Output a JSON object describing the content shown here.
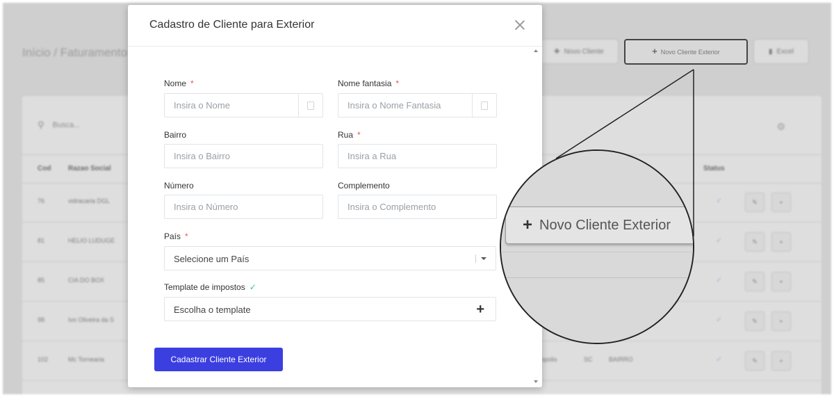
{
  "background": {
    "breadcrumb": "Início / Faturamento",
    "buttons": {
      "novo_cliente": "Novo Cliente",
      "novo_cliente_exterior": "Novo Cliente Exterior",
      "excel": "Excel"
    },
    "search_placeholder": "Busca...",
    "table": {
      "headers": {
        "cod": "Cod",
        "razao_social": "Razao Social",
        "status": "Status"
      },
      "rows": [
        {
          "cod": "76",
          "name": "vidracaria DGL",
          "city": "",
          "uf": "",
          "bairro": ""
        },
        {
          "cod": "81",
          "name": "HELIO LUDUGE",
          "city": "",
          "uf": "",
          "bairro": ""
        },
        {
          "cod": "85",
          "name": "CIA DO BOX",
          "city": "",
          "uf": "",
          "bairro": ""
        },
        {
          "cod": "98",
          "name": "Ivo Oliveira da S",
          "city": "",
          "uf": "",
          "bairro": ""
        },
        {
          "cod": "102",
          "name": "Mc Tornearia",
          "city": "opolis",
          "uf": "SC",
          "bairro": "BAIRRO"
        }
      ]
    }
  },
  "modal": {
    "title": "Cadastro de Cliente para Exterior",
    "fields": {
      "nome": {
        "label": "Nome",
        "required_mark": "*",
        "placeholder": "Insira o Nome"
      },
      "nome_fantasia": {
        "label": "Nome fantasia",
        "required_mark": "*",
        "placeholder": "Insira o Nome Fantasia"
      },
      "bairro": {
        "label": "Bairro",
        "placeholder": "Insira o Bairro"
      },
      "rua": {
        "label": "Rua",
        "required_mark": "*",
        "placeholder": "Insira a Rua"
      },
      "numero": {
        "label": "Número",
        "placeholder": "Insira o Número"
      },
      "complemento": {
        "label": "Complemento",
        "placeholder": "Insira o Complemento"
      },
      "pais": {
        "label": "País",
        "required_mark": "*",
        "selected": "Selecione um País"
      },
      "template": {
        "label": "Template de impostos",
        "selected": "Escolha o template"
      }
    },
    "submit_label": "Cadastrar Cliente Exterior"
  },
  "zoom": {
    "button_label": "Novo Cliente Exterior"
  },
  "colors": {
    "primary": "#3b3fe0",
    "required": "#e8574e",
    "valid_check": "#3ac27d"
  }
}
